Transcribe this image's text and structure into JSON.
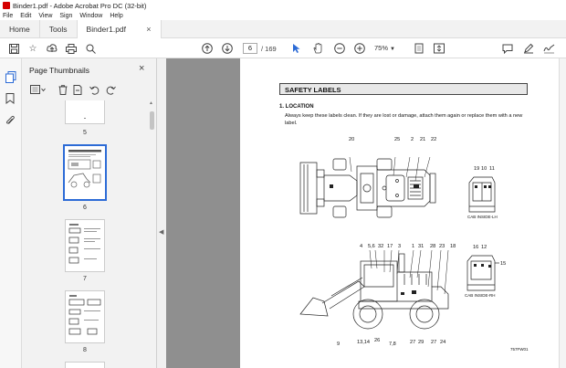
{
  "window": {
    "title": "Binder1.pdf - Adobe Acrobat Pro DC (32-bit)"
  },
  "menu": [
    "File",
    "Edit",
    "View",
    "Sign",
    "Window",
    "Help"
  ],
  "tabs": {
    "home": "Home",
    "tools": "Tools",
    "document": "Binder1.pdf",
    "close": "×"
  },
  "toolbar": {
    "page_current": "6",
    "page_total": "/ 169",
    "zoom": "75%",
    "icons": [
      "save-icon",
      "bookmark-star-icon",
      "upload-icon",
      "print-icon",
      "search-icon",
      "page-up-icon",
      "page-down-icon",
      "select-arrow-icon",
      "hand-icon",
      "zoom-out-icon",
      "zoom-in-icon",
      "fit-page-icon",
      "scroll-mode-icon",
      "comment-icon",
      "highlight-icon",
      "sign-icon"
    ]
  },
  "sidebar": {
    "title": "Page Thumbnails",
    "close": "×",
    "thumbnails": [
      {
        "label": "5",
        "selected": false
      },
      {
        "label": "6",
        "selected": true
      },
      {
        "label": "7",
        "selected": false
      },
      {
        "label": "8",
        "selected": false
      }
    ]
  },
  "document": {
    "section_title": "SAFETY LABELS",
    "heading": "1. LOCATION",
    "paragraph": "Always keep these labels clean.  If they are lost or damage, attach them again or replace them with a new label.",
    "top_callouts": [
      "20",
      "25",
      "2",
      "21",
      "22"
    ],
    "cab_lh_callouts": [
      "19",
      "10",
      "11"
    ],
    "cab_lh_label": "CAB INSIDE-LH",
    "side_callouts_top": [
      "4",
      "5,6",
      "32",
      "17",
      "3",
      "1",
      "31",
      "28",
      "23",
      "18"
    ],
    "side_callouts_bottom": [
      "9",
      "13,14",
      "26",
      "7,8",
      "27",
      "29",
      "27",
      "24"
    ],
    "cab_rh_callouts": [
      "16",
      "12",
      "15"
    ],
    "cab_rh_label": "CAB INSIDE-RH",
    "figure_code": "757FW01"
  },
  "colors": {
    "accent": "#2c6bd6",
    "viewer_bg": "#8f8f8f",
    "acrobat_red": "#d40000"
  }
}
